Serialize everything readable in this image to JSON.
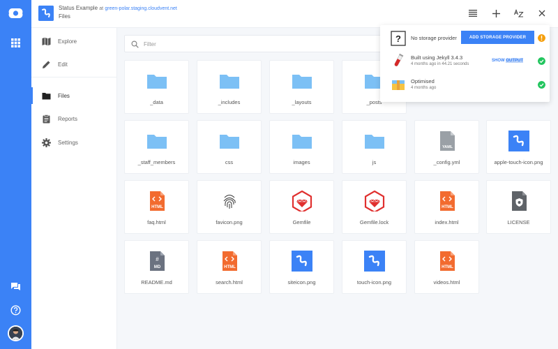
{
  "header": {
    "site_name": "Status Example",
    "at_label": "at",
    "site_url": "green-polar.staging.cloudvent.net",
    "section": "Files"
  },
  "sidenav": {
    "items": [
      {
        "label": "Explore",
        "icon": "map-icon"
      },
      {
        "label": "Edit",
        "icon": "pencil-icon"
      },
      {
        "label": "Files",
        "icon": "folder-icon",
        "active": true
      },
      {
        "label": "Reports",
        "icon": "clipboard-icon"
      },
      {
        "label": "Settings",
        "icon": "gear-icon"
      }
    ]
  },
  "filter": {
    "placeholder": "Filter"
  },
  "files": [
    {
      "name": "_data",
      "type": "folder"
    },
    {
      "name": "_includes",
      "type": "folder"
    },
    {
      "name": "_layouts",
      "type": "folder"
    },
    {
      "name": "_posts",
      "type": "folder"
    },
    {
      "name": "",
      "type": "hidden"
    },
    {
      "name": "",
      "type": "hidden"
    },
    {
      "name": "_staff_members",
      "type": "folder"
    },
    {
      "name": "css",
      "type": "folder"
    },
    {
      "name": "images",
      "type": "folder"
    },
    {
      "name": "js",
      "type": "folder"
    },
    {
      "name": "_config.yml",
      "type": "yaml"
    },
    {
      "name": "apple-touch-icon.png",
      "type": "image"
    },
    {
      "name": "faq.html",
      "type": "html"
    },
    {
      "name": "favicon.png",
      "type": "fingerprint"
    },
    {
      "name": "Gemfile",
      "type": "ruby"
    },
    {
      "name": "Gemfile.lock",
      "type": "ruby"
    },
    {
      "name": "index.html",
      "type": "html"
    },
    {
      "name": "LICENSE",
      "type": "license"
    },
    {
      "name": "README.md",
      "type": "markdown"
    },
    {
      "name": "search.html",
      "type": "html"
    },
    {
      "name": "siteicon.png",
      "type": "image"
    },
    {
      "name": "touch-icon.png",
      "type": "image"
    },
    {
      "name": "videos.html",
      "type": "html"
    }
  ],
  "notifications": {
    "storage": {
      "text": "No storage provider",
      "button": "ADD STORAGE PROVIDER"
    },
    "build": {
      "title": "Built using Jekyll 3.4.3",
      "meta": "4 months ago in 44.21 seconds",
      "show": "SHOW",
      "output": "OUTPUT"
    },
    "optimise": {
      "title": "Optimised",
      "meta": "4 months ago"
    }
  },
  "colors": {
    "brand": "#3b82f6",
    "folder": "#7cc0f5",
    "html": "#f26b2f",
    "ruby": "#e0302f",
    "success": "#22c55e",
    "warning": "#f59e0b"
  },
  "icon_labels": {
    "html": "HTML",
    "yaml": "YAML",
    "markdown": "MD",
    "markdown_symbol": "#",
    "unknown": "?"
  }
}
